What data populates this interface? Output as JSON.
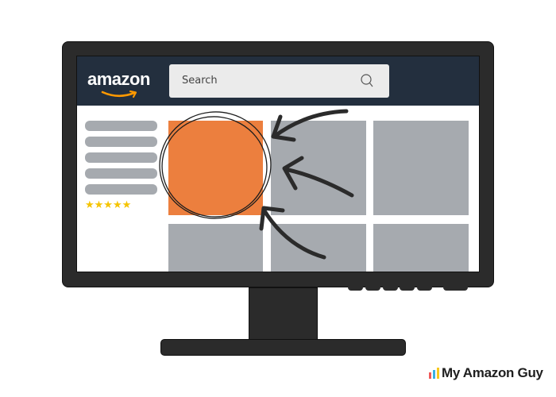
{
  "header": {
    "logo_text": "amazon",
    "search_placeholder": "Search",
    "search_icon": "magnifier-icon"
  },
  "sidebar": {
    "filter_bars": 5,
    "rating_stars": 5,
    "rating_label": "★★★★★"
  },
  "product_grid": {
    "columns": 3,
    "rows": 2,
    "highlighted_index": 0,
    "tile_color": "#a6aaaf",
    "highlight_color": "#ec7f3e"
  },
  "annotation": {
    "arrows": 3,
    "circle_target": "first-product-tile"
  },
  "colors": {
    "header_bg": "#232f3e",
    "monitor": "#2b2b2b",
    "amazon_smile": "#f90"
  },
  "brand": {
    "name": "My Amazon Guy",
    "icon": "bar-chart-icon",
    "icon_colors": [
      "#f05a5a",
      "#3ab0e2",
      "#f7c81e"
    ]
  }
}
